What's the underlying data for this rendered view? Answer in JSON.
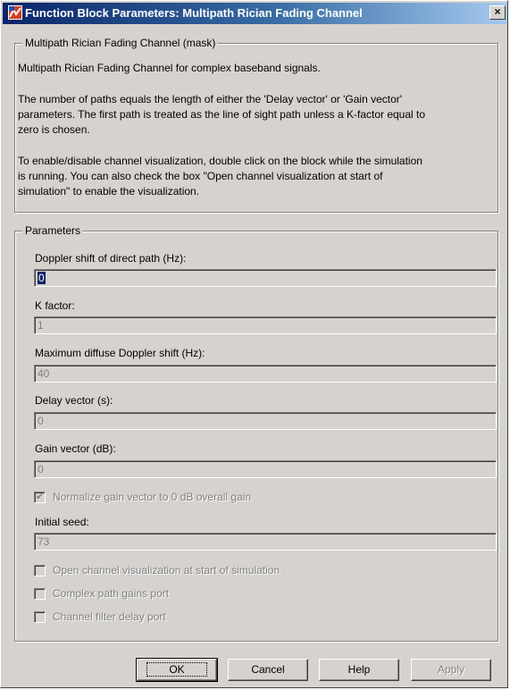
{
  "window": {
    "title": "Function Block Parameters: Multipath Rician Fading Channel",
    "close_glyph": "×",
    "icon": "matlab-block-icon"
  },
  "mask": {
    "group_title": "Multipath Rician Fading Channel (mask)",
    "desc1": "Multipath Rician Fading Channel for complex baseband signals.",
    "desc2_line1": "The number of paths equals the length of either the 'Delay vector' or 'Gain vector'",
    "desc2_line2": "parameters. The first path is treated as the line of sight path unless a K-factor equal to",
    "desc2_line3": "zero is chosen.",
    "desc3_line1": "To enable/disable channel visualization, double click on the block while the simulation",
    "desc3_line2": "is running.  You can also check the box \"Open channel visualization at start of",
    "desc3_line3": "simulation\" to enable the visualization."
  },
  "params": {
    "group_title": "Parameters",
    "doppler_direct": {
      "label": "Doppler shift of direct path (Hz):",
      "value": "0"
    },
    "k_factor": {
      "label": "K factor:",
      "value": "1"
    },
    "max_doppler": {
      "label": "Maximum diffuse Doppler shift (Hz):",
      "value": "40"
    },
    "delay_vector": {
      "label": "Delay vector (s):",
      "value": "0"
    },
    "gain_vector": {
      "label": "Gain vector (dB):",
      "value": "0"
    },
    "normalize": {
      "label": "Normalize gain vector to 0 dB overall gain",
      "checked": true,
      "mark": "✔"
    },
    "initial_seed": {
      "label": "Initial seed:",
      "value": "73"
    },
    "open_visualization": {
      "label": "Open channel visualization at start of simulation",
      "checked": false
    },
    "complex_path_gains": {
      "label": "Complex path gains port",
      "checked": false
    },
    "channel_filter_delay": {
      "label": "Channel filter delay port",
      "checked": false
    }
  },
  "buttons": {
    "ok": "OK",
    "cancel": "Cancel",
    "help": "Help",
    "apply": "Apply"
  }
}
